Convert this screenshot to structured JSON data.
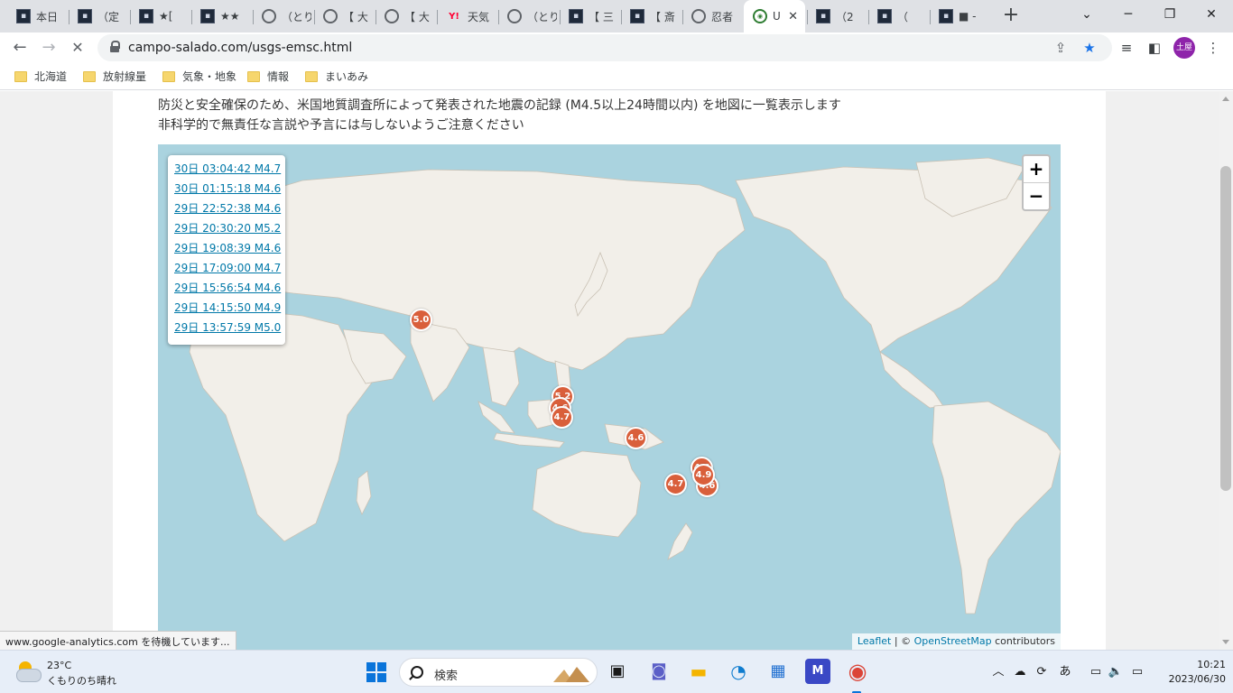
{
  "browser": {
    "tabs": [
      {
        "favicon": "doc-icon",
        "title": "本日"
      },
      {
        "favicon": "doc-icon",
        "title": "（定"
      },
      {
        "favicon": "doc-icon",
        "title": "★["
      },
      {
        "favicon": "doc-icon",
        "title": "★★"
      },
      {
        "favicon": "globe-icon",
        "title": "（とり"
      },
      {
        "favicon": "globe-icon",
        "title": "【 大"
      },
      {
        "favicon": "globe-icon",
        "title": "【 大"
      },
      {
        "favicon": "yahoo-icon",
        "title": "天気"
      },
      {
        "favicon": "globe-icon",
        "title": "（とり"
      },
      {
        "favicon": "doc-icon",
        "title": "【 三"
      },
      {
        "favicon": "doc-icon",
        "title": "【 斎"
      },
      {
        "favicon": "globe-icon",
        "title": "忍者"
      },
      {
        "favicon": "emsc-icon",
        "title": "U",
        "active": true
      },
      {
        "favicon": "doc-icon",
        "title": "（2"
      },
      {
        "favicon": "doc-icon",
        "title": "（"
      },
      {
        "favicon": "doc-icon",
        "title": "■ -"
      }
    ],
    "url": "campo-salado.com/usgs-emsc.html",
    "profile_initials": "土屋",
    "bookmarks": [
      "北海道",
      "放射線量",
      "気象・地象",
      "情報",
      "まいあみ"
    ]
  },
  "page": {
    "intro_line1": "防災と安全確保のため、米国地質調査所によって発表された地震の記録 (M4.5以上24時間以内) を地図に一覧表示します",
    "intro_line2": "非科学的で無責任な言説や予言には与しないようご注意ください",
    "earthquake_list": [
      "30日 03:04:42 M4.7",
      "30日 01:15:18 M4.6",
      "29日 22:52:38 M4.6",
      "29日 20:30:20 M5.2",
      "29日 19:08:39 M4.6",
      "29日 17:09:00 M4.7",
      "29日 15:56:54 M4.6",
      "29日 14:15:50 M4.9",
      "29日 13:57:59 M5.0"
    ],
    "map_markers": [
      "5.0",
      "5.2",
      "4.6",
      "4.7",
      "4.6",
      "4.6",
      "4.9",
      "4.6",
      "4.7"
    ],
    "zoom_in": "+",
    "zoom_out": "−",
    "attribution": {
      "leaflet": "Leaflet",
      "sep": " | © ",
      "osm": "OpenStreetMap",
      "suffix": " contributors"
    },
    "status_text": "www.google-analytics.com を待機しています..."
  },
  "taskbar": {
    "temperature": "23°C",
    "weather": "くもりのち晴れ",
    "search_placeholder": "検索",
    "ime": "あ",
    "time": "10:21",
    "date": "2023/06/30"
  },
  "colors": {
    "map_water": "#aad3df",
    "map_land": "#f2efe9",
    "marker": "#d95f3b",
    "link": "#0078a8"
  }
}
